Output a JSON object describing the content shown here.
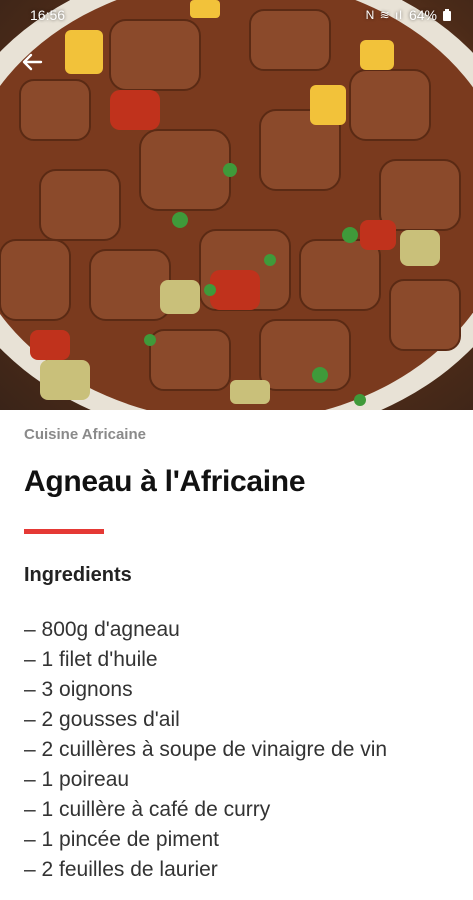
{
  "status_bar": {
    "time": "16:56",
    "icons": "N ≋ ıl",
    "battery": "64%"
  },
  "colors": {
    "accent": "#e53935",
    "category_text": "#8a8a8a"
  },
  "hero_image": {
    "subject": "lamb stew with peppers and herbs"
  },
  "recipe": {
    "category": "Cuisine Africaine",
    "title": "Agneau à l'Africaine",
    "ingredients_heading": "Ingredients",
    "ingredients": [
      "– 800g d'agneau",
      "– 1 filet d'huile",
      "– 3 oignons",
      "– 2 gousses d'ail",
      "– 2 cuillères à soupe de vinaigre de vin",
      "–  1 poireau",
      "– 1 cuillère à café de curry",
      "– 1 pincée de piment",
      "– 2 feuilles de laurier"
    ]
  }
}
